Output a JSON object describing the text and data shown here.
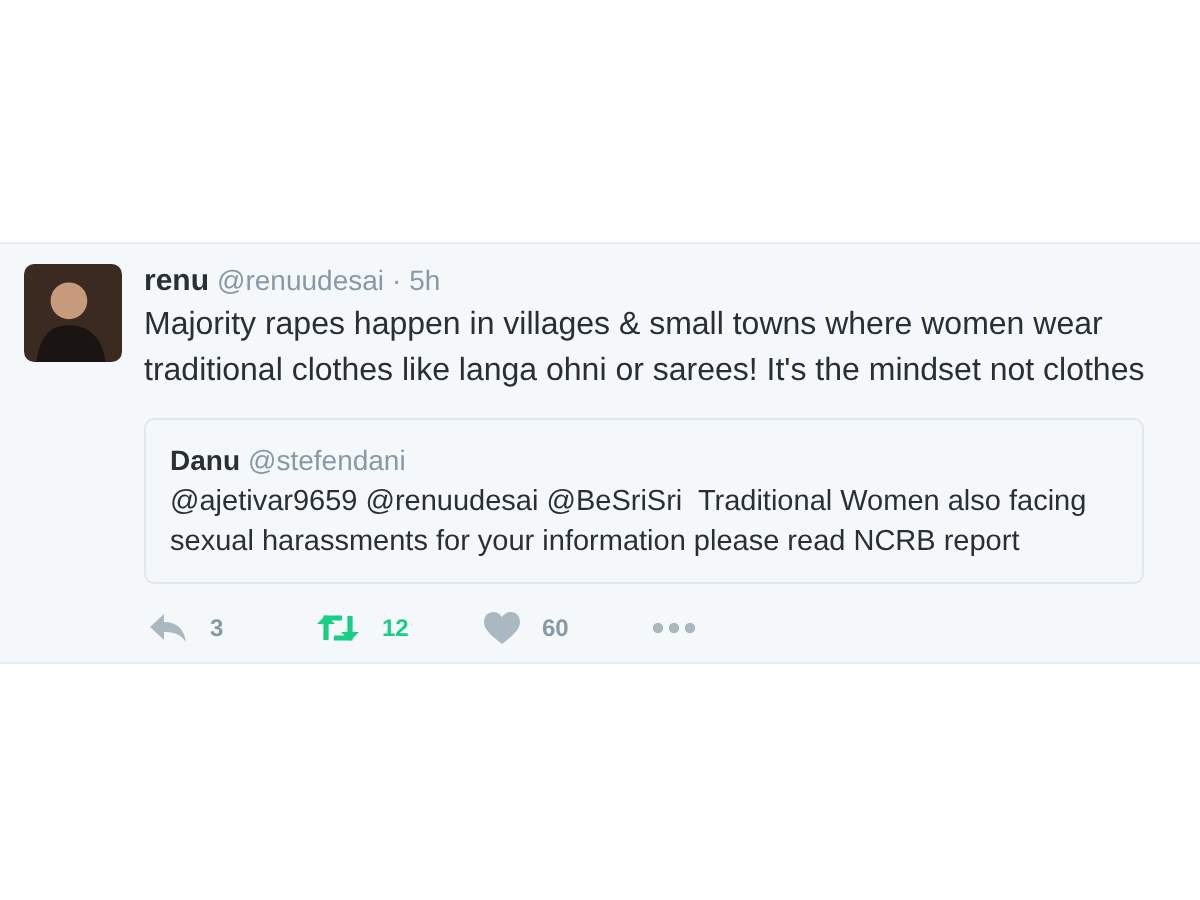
{
  "tweet": {
    "name": "renu",
    "handle": "@renuudesai",
    "time": "· 5h",
    "text": "Majority rapes happen in villages & small towns where women wear traditional clothes like langa ohni or sarees! It's the mindset not clothes",
    "quote": {
      "name": "Danu",
      "handle": "@stefendani",
      "text": "@ajetivar9659 @renuudesai @BeSriSri  Traditional Women also facing sexual harassments for your information please read NCRB report"
    },
    "actions": [
      {
        "kind": "reply",
        "count": "3",
        "active": false
      },
      {
        "kind": "retweet",
        "count": "12",
        "active": true
      },
      {
        "kind": "like",
        "count": "60",
        "active": false
      },
      {
        "kind": "more",
        "active": false
      }
    ]
  }
}
